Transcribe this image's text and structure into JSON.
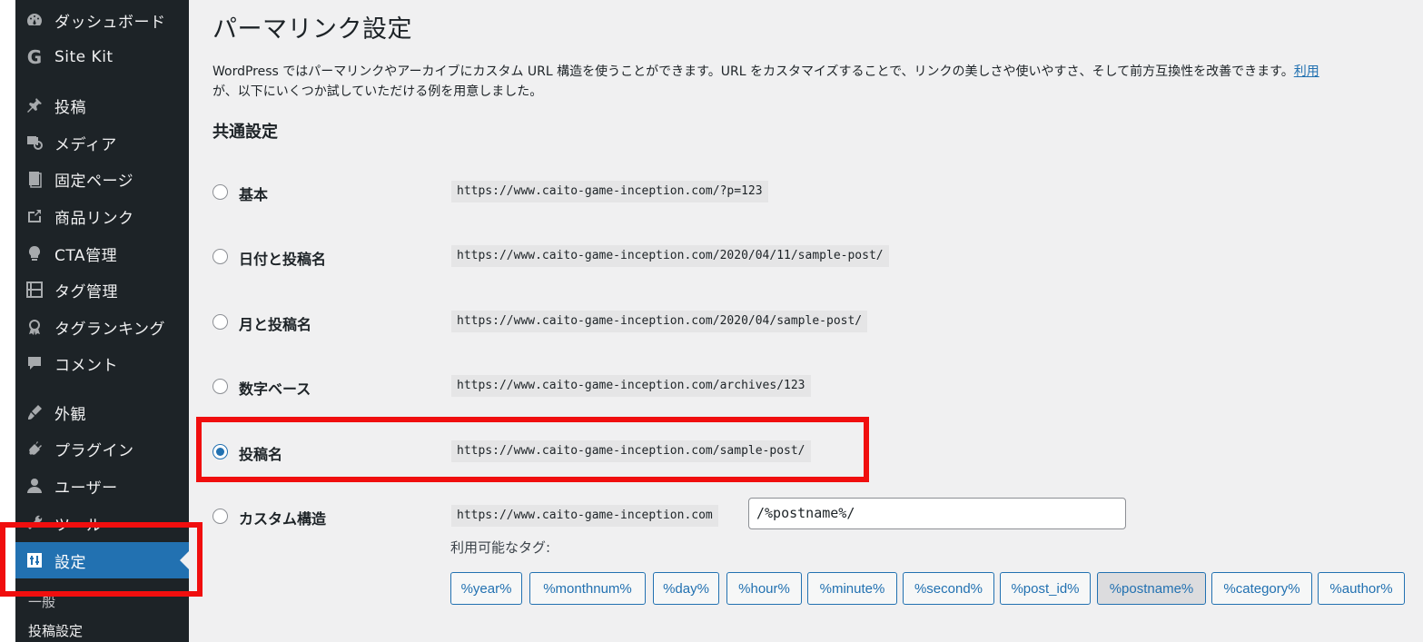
{
  "sidebar": {
    "items": [
      {
        "label": "ダッシュボード",
        "icon": "dashboard-icon"
      },
      {
        "label": "Site Kit",
        "icon": "site-kit-icon"
      },
      {
        "label": "投稿",
        "icon": "pin-icon"
      },
      {
        "label": "メディア",
        "icon": "media-icon"
      },
      {
        "label": "固定ページ",
        "icon": "page-icon"
      },
      {
        "label": "商品リンク",
        "icon": "external-link-icon"
      },
      {
        "label": "CTA管理",
        "icon": "lightbulb-icon"
      },
      {
        "label": "タグ管理",
        "icon": "tag-manager-icon"
      },
      {
        "label": "タグランキング",
        "icon": "award-icon"
      },
      {
        "label": "コメント",
        "icon": "comment-icon"
      },
      {
        "label": "外観",
        "icon": "appearance-icon"
      },
      {
        "label": "プラグイン",
        "icon": "plugin-icon"
      },
      {
        "label": "ユーザー",
        "icon": "user-icon"
      },
      {
        "label": "ツール",
        "icon": "tools-icon"
      },
      {
        "label": "設定",
        "icon": "settings-icon",
        "active": true
      }
    ],
    "submenu": [
      "一般",
      "投稿設定"
    ]
  },
  "main": {
    "title": "パーマリンク設定",
    "description_line1": "WordPress ではパーマリンクやアーカイブにカスタム URL 構造を使うことができます。URL をカスタマイズすることで、リンクの美しさや使いやすさ、そして前方互換性を改善できます。",
    "description_link": "利用",
    "description_line2": "が、以下にいくつか試していただける例を用意しました。",
    "section_title": "共通設定",
    "options": [
      {
        "label": "基本",
        "example": "https://www.caito-game-inception.com/?p=123",
        "checked": false
      },
      {
        "label": "日付と投稿名",
        "example": "https://www.caito-game-inception.com/2020/04/11/sample-post/",
        "checked": false
      },
      {
        "label": "月と投稿名",
        "example": "https://www.caito-game-inception.com/2020/04/sample-post/",
        "checked": false
      },
      {
        "label": "数字ベース",
        "example": "https://www.caito-game-inception.com/archives/123",
        "checked": false
      },
      {
        "label": "投稿名",
        "example": "https://www.caito-game-inception.com/sample-post/",
        "checked": true
      },
      {
        "label": "カスタム構造",
        "example": "https://www.caito-game-inception.com",
        "checked": false
      }
    ],
    "custom_structure_value": "/%postname%/",
    "available_tags_label": "利用可能なタグ:",
    "tags": [
      "%year%",
      "%monthnum%",
      "%day%",
      "%hour%",
      "%minute%",
      "%second%",
      "%post_id%",
      "%postname%",
      "%category%",
      "%author%"
    ],
    "selected_tag": "%postname%"
  },
  "colors": {
    "highlight": "#f00e0e",
    "accent": "#2271b1",
    "sidebar_bg": "#1d2327"
  }
}
